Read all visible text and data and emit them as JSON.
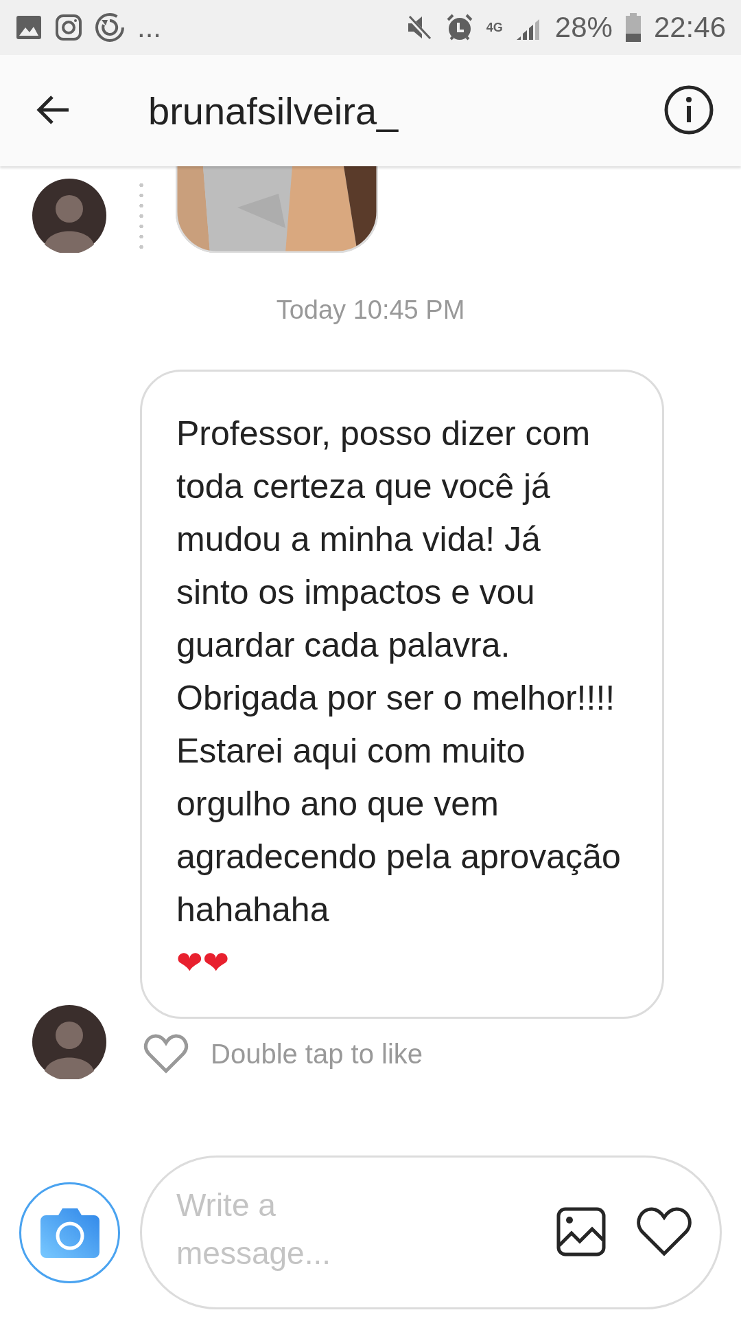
{
  "status_bar": {
    "overflow": "...",
    "network": "4G",
    "battery": "28%",
    "time": "22:46"
  },
  "header": {
    "title": "brunafsilveira_"
  },
  "thread": {
    "timestamp": "Today 10:45 PM",
    "message": {
      "text": "Professor, posso dizer com toda certeza que você já mudou a minha vida! Já sinto os impactos e vou guardar cada palavra. Obrigada por ser o melhor!!!! Estarei aqui com muito orgulho ano que vem agradecendo pela aprovação hahahaha",
      "emoji": "❤❤"
    },
    "like_hint": "Double tap to like"
  },
  "composer": {
    "placeholder": "Write a message..."
  }
}
